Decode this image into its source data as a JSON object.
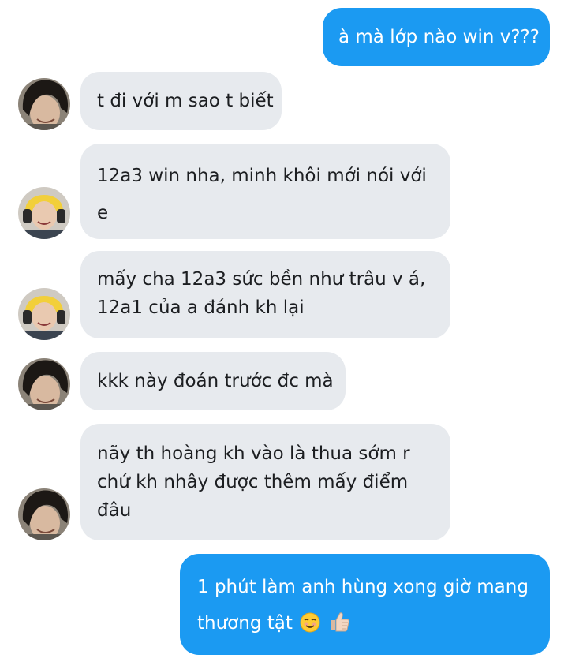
{
  "messages": [
    {
      "direction": "outgoing",
      "text": "à mà lớp nào win v???"
    },
    {
      "direction": "incoming",
      "avatar": "avatar-boy-long-hair",
      "text": "t đi với m sao t biết"
    },
    {
      "direction": "incoming",
      "avatar": "avatar-girl-yellow-headphones",
      "text_line1": "12a3 win nha, minh khôi mới nói với",
      "text_line2": "e"
    },
    {
      "direction": "incoming",
      "avatar": "avatar-girl-yellow-headphones",
      "text_line1": "mấy cha 12a3 sức bền như trâu v á,",
      "text_line2": "12a1 của a đánh kh lại"
    },
    {
      "direction": "incoming",
      "avatar": "avatar-boy-long-hair",
      "text": "kkk này đoán trước đc mà"
    },
    {
      "direction": "incoming",
      "avatar": "avatar-boy-long-hair",
      "text_line1": "nãy th hoàng kh vào là thua sớm r",
      "text_line2": "chứ kh nhây được thêm mấy điểm",
      "text_line3": "đâu"
    },
    {
      "direction": "outgoing",
      "text_line1": "1 phút làm anh hùng xong giờ mang",
      "text_line2": "thương tật",
      "emojis": [
        "smiling-face-icon",
        "thumbs-up-icon"
      ]
    }
  ],
  "colors": {
    "outgoing_bubble": "#1b9af2",
    "incoming_bubble": "#e7eaee",
    "incoming_text": "#1c1e21",
    "outgoing_text": "#ffffff"
  }
}
